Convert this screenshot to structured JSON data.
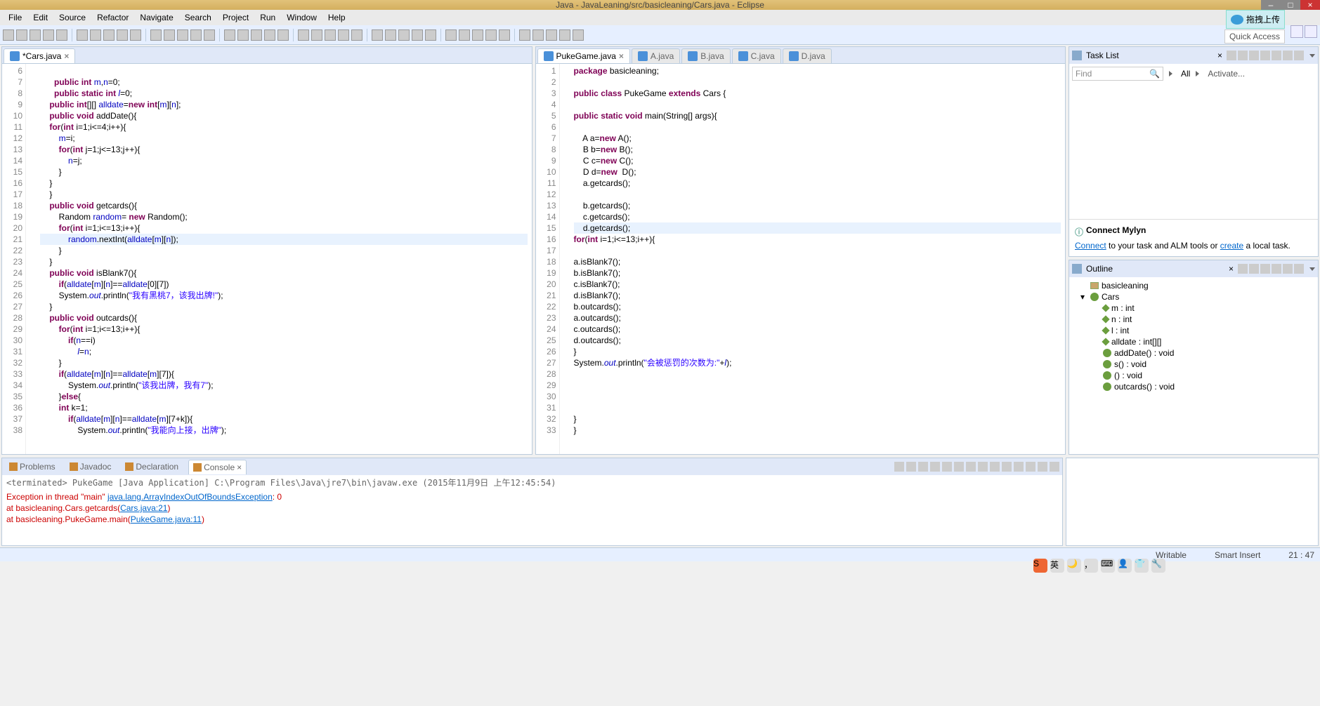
{
  "window": {
    "title": "Java - JavaLeaning/src/basicleaning/Cars.java - Eclipse"
  },
  "menus": [
    "File",
    "Edit",
    "Source",
    "Refactor",
    "Navigate",
    "Search",
    "Project",
    "Run",
    "Window",
    "Help"
  ],
  "cloudtip": "拖拽上传",
  "quickaccess": "Quick Access",
  "editor1": {
    "tab": "*Cars.java",
    "lines_start": 6,
    "code": [
      {
        "n": 6,
        "t": ""
      },
      {
        "n": 7,
        "t": "      <kw>public</kw> <kw>int</kw> <field>m</field>,<field>n</field>=0;"
      },
      {
        "n": 8,
        "t": "      <kw>public</kw> <kw>static</kw> <kw>int</kw> <sfield>l</sfield>=0;"
      },
      {
        "n": 9,
        "t": "    <kw>public</kw> <kw>int</kw>[][] <field>alldate</field>=<kw>new</kw> <kw>int</kw>[<field>m</field>][<field>n</field>];"
      },
      {
        "n": 10,
        "t": "    <kw>public</kw> <kw>void</kw> addDate(){"
      },
      {
        "n": 11,
        "t": "    <kw>for</kw>(<kw>int</kw> i=1;i<=4;i++){"
      },
      {
        "n": 12,
        "t": "        <field>m</field>=i;"
      },
      {
        "n": 13,
        "t": "        <kw>for</kw>(<kw>int</kw> j=1;j<=13;j++){"
      },
      {
        "n": 14,
        "t": "            <field>n</field>=j;"
      },
      {
        "n": 15,
        "t": "        }"
      },
      {
        "n": 16,
        "t": "    }"
      },
      {
        "n": 17,
        "t": "    }"
      },
      {
        "n": 18,
        "t": "    <kw>public</kw> <kw>void</kw> getcards(){"
      },
      {
        "n": 19,
        "t": "        Random <field>random</field>= <kw>new</kw> Random();"
      },
      {
        "n": 20,
        "t": "        <kw>for</kw>(<kw>int</kw> i=1;i<=13;i++){"
      },
      {
        "n": 21,
        "t": "            <field>random</field>.nextInt(<field>alldate</field>[<field>m</field>][<field>n</field>]);",
        "hl": true
      },
      {
        "n": 22,
        "t": "        }"
      },
      {
        "n": 23,
        "t": "    }"
      },
      {
        "n": 24,
        "t": "    <kw>public</kw> <kw>void</kw> isBlank7(){"
      },
      {
        "n": 25,
        "t": "        <kw>if</kw>(<field>alldate</field>[<field>m</field>][<field>n</field>]==<field>alldate</field>[0][7])"
      },
      {
        "n": 26,
        "t": "        System.<sfield>out</sfield>.println(<str>\"我有黑桃7，该我出牌!\"</str>);"
      },
      {
        "n": 27,
        "t": "    }"
      },
      {
        "n": 28,
        "t": "    <kw>public</kw> <kw>void</kw> outcards(){"
      },
      {
        "n": 29,
        "t": "        <kw>for</kw>(<kw>int</kw> i=1;i<=13;i++){"
      },
      {
        "n": 30,
        "t": "            <kw>if</kw>(<field>n</field>==i)"
      },
      {
        "n": 31,
        "t": "                <sfield>l</sfield>=<field>n</field>;"
      },
      {
        "n": 32,
        "t": "        }"
      },
      {
        "n": 33,
        "t": "        <kw>if</kw>(<field>alldate</field>[<field>m</field>][<field>n</field>]==<field>alldate</field>[<field>m</field>][7]){"
      },
      {
        "n": 34,
        "t": "            System.<sfield>out</sfield>.println(<str>\"该我出牌，我有7\"</str>);"
      },
      {
        "n": 35,
        "t": "        }<kw>else</kw>{"
      },
      {
        "n": 36,
        "t": "        <kw>int</kw> k=1;"
      },
      {
        "n": 37,
        "t": "            <kw>if</kw>(<field>alldate</field>[<field>m</field>][<field>n</field>]==<field>alldate</field>[<field>m</field>][7+k]){"
      },
      {
        "n": 38,
        "t": "                System.<sfield>out</sfield>.println(<str>\"我能向上接，出牌\"</str>);"
      }
    ]
  },
  "editor2": {
    "tab": "PukeGame.java",
    "othertabs": [
      "A.java",
      "B.java",
      "C.java",
      "D.java"
    ],
    "code": [
      {
        "n": 1,
        "t": "<kw>package</kw> basicleaning;"
      },
      {
        "n": 2,
        "t": ""
      },
      {
        "n": 3,
        "t": "<kw>public</kw> <kw>class</kw> PukeGame <kw>extends</kw> Cars {"
      },
      {
        "n": 4,
        "t": ""
      },
      {
        "n": 5,
        "t": "<kw>public</kw> <kw>static</kw> <kw>void</kw> main(String[] args){"
      },
      {
        "n": 6,
        "t": ""
      },
      {
        "n": 7,
        "t": "    A a=<kw>new</kw> A();"
      },
      {
        "n": 8,
        "t": "    B b=<kw>new</kw> B();"
      },
      {
        "n": 9,
        "t": "    C c=<kw>new</kw> C();"
      },
      {
        "n": 10,
        "t": "    D d=<kw>new</kw>  D();"
      },
      {
        "n": 11,
        "t": "    a.getcards();"
      },
      {
        "n": 12,
        "t": ""
      },
      {
        "n": 13,
        "t": "    b.getcards();"
      },
      {
        "n": 14,
        "t": "    c.getcards();"
      },
      {
        "n": 15,
        "t": "    d.getcards();",
        "hl": true
      },
      {
        "n": 16,
        "t": "<kw>for</kw>(<kw>int</kw> i=1;i<=13;i++){"
      },
      {
        "n": 17,
        "t": ""
      },
      {
        "n": 18,
        "t": "a.isBlank7();"
      },
      {
        "n": 19,
        "t": "b.isBlank7();"
      },
      {
        "n": 20,
        "t": "c.isBlank7();"
      },
      {
        "n": 21,
        "t": "d.isBlank7();"
      },
      {
        "n": 22,
        "t": "b.outcards();"
      },
      {
        "n": 23,
        "t": "a.outcards();"
      },
      {
        "n": 24,
        "t": "c.outcards();"
      },
      {
        "n": 25,
        "t": "d.outcards();"
      },
      {
        "n": 26,
        "t": "}"
      },
      {
        "n": 27,
        "t": "System.<sfield>out</sfield>.println(<str>\"会被惩罚的次数为:\"</str>+<sfield>l</sfield>);"
      },
      {
        "n": 28,
        "t": ""
      },
      {
        "n": 29,
        "t": ""
      },
      {
        "n": 30,
        "t": ""
      },
      {
        "n": 31,
        "t": ""
      },
      {
        "n": 32,
        "t": "}"
      },
      {
        "n": 33,
        "t": "}"
      }
    ]
  },
  "tasklist": {
    "title": "Task List",
    "find": "Find",
    "all": "All",
    "activate": "Activate..."
  },
  "mylyn": {
    "title": "Connect Mylyn",
    "connect": "Connect",
    "mid": " to your task and ALM tools or ",
    "create": "create",
    "tail": " a local task."
  },
  "outline": {
    "title": "Outline",
    "nodes": [
      {
        "lvl": 1,
        "ico": "pkg",
        "txt": "basicleaning"
      },
      {
        "lvl": 1,
        "ico": "cls",
        "txt": "Cars",
        "expand": true
      },
      {
        "lvl": 2,
        "ico": "fld",
        "txt": "m : int"
      },
      {
        "lvl": 2,
        "ico": "fld",
        "txt": "n : int"
      },
      {
        "lvl": 2,
        "ico": "fld",
        "txt": "l : int",
        "static": true
      },
      {
        "lvl": 2,
        "ico": "fld",
        "txt": "alldate : int[][]"
      },
      {
        "lvl": 2,
        "ico": "meth",
        "txt": "addDate() : void"
      },
      {
        "lvl": 2,
        "ico": "meth",
        "txt": "s() : void"
      },
      {
        "lvl": 2,
        "ico": "meth",
        "txt": "() : void"
      },
      {
        "lvl": 2,
        "ico": "meth",
        "txt": "outcards() : void"
      }
    ]
  },
  "console": {
    "tabs": [
      "Problems",
      "Javadoc",
      "Declaration",
      "Console"
    ],
    "header": "<terminated> PukeGame [Java Application] C:\\Program Files\\Java\\jre7\\bin\\javaw.exe (2015年11月9日 上午12:45:54)",
    "lines": [
      {
        "t": "Exception in thread \"main\" ",
        "link": "java.lang.ArrayIndexOutOfBoundsException",
        "tail": ": 0"
      },
      {
        "t": "\tat basicleaning.Cars.getcards(",
        "link": "Cars.java:21",
        "tail": ")"
      },
      {
        "t": "\tat basicleaning.PukeGame.main(",
        "link": "PukeGame.java:11",
        "tail": ")"
      }
    ]
  },
  "statusbar": {
    "writable": "Writable",
    "insert": "Smart Insert",
    "pos": "21 : 47"
  }
}
